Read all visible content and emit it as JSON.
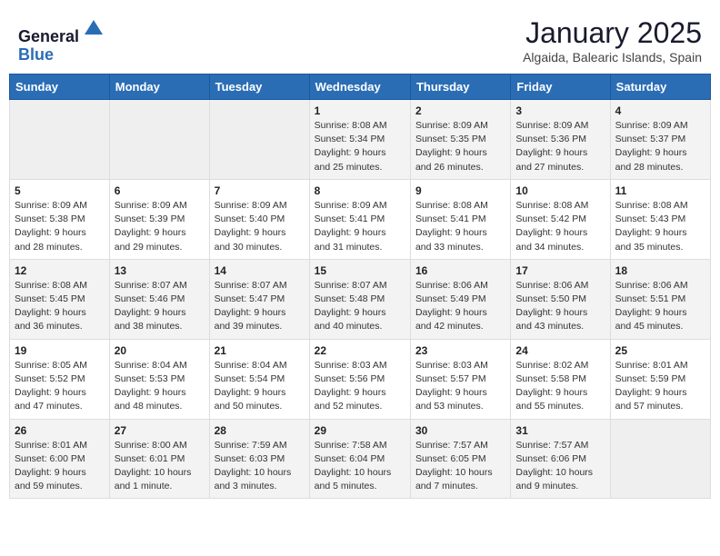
{
  "header": {
    "logo_line1": "General",
    "logo_line2": "Blue",
    "month": "January 2025",
    "location": "Algaida, Balearic Islands, Spain"
  },
  "weekdays": [
    "Sunday",
    "Monday",
    "Tuesday",
    "Wednesday",
    "Thursday",
    "Friday",
    "Saturday"
  ],
  "weeks": [
    [
      {
        "day": "",
        "info": ""
      },
      {
        "day": "",
        "info": ""
      },
      {
        "day": "",
        "info": ""
      },
      {
        "day": "1",
        "info": "Sunrise: 8:08 AM\nSunset: 5:34 PM\nDaylight: 9 hours\nand 25 minutes."
      },
      {
        "day": "2",
        "info": "Sunrise: 8:09 AM\nSunset: 5:35 PM\nDaylight: 9 hours\nand 26 minutes."
      },
      {
        "day": "3",
        "info": "Sunrise: 8:09 AM\nSunset: 5:36 PM\nDaylight: 9 hours\nand 27 minutes."
      },
      {
        "day": "4",
        "info": "Sunrise: 8:09 AM\nSunset: 5:37 PM\nDaylight: 9 hours\nand 28 minutes."
      }
    ],
    [
      {
        "day": "5",
        "info": "Sunrise: 8:09 AM\nSunset: 5:38 PM\nDaylight: 9 hours\nand 28 minutes."
      },
      {
        "day": "6",
        "info": "Sunrise: 8:09 AM\nSunset: 5:39 PM\nDaylight: 9 hours\nand 29 minutes."
      },
      {
        "day": "7",
        "info": "Sunrise: 8:09 AM\nSunset: 5:40 PM\nDaylight: 9 hours\nand 30 minutes."
      },
      {
        "day": "8",
        "info": "Sunrise: 8:09 AM\nSunset: 5:41 PM\nDaylight: 9 hours\nand 31 minutes."
      },
      {
        "day": "9",
        "info": "Sunrise: 8:08 AM\nSunset: 5:41 PM\nDaylight: 9 hours\nand 33 minutes."
      },
      {
        "day": "10",
        "info": "Sunrise: 8:08 AM\nSunset: 5:42 PM\nDaylight: 9 hours\nand 34 minutes."
      },
      {
        "day": "11",
        "info": "Sunrise: 8:08 AM\nSunset: 5:43 PM\nDaylight: 9 hours\nand 35 minutes."
      }
    ],
    [
      {
        "day": "12",
        "info": "Sunrise: 8:08 AM\nSunset: 5:45 PM\nDaylight: 9 hours\nand 36 minutes."
      },
      {
        "day": "13",
        "info": "Sunrise: 8:07 AM\nSunset: 5:46 PM\nDaylight: 9 hours\nand 38 minutes."
      },
      {
        "day": "14",
        "info": "Sunrise: 8:07 AM\nSunset: 5:47 PM\nDaylight: 9 hours\nand 39 minutes."
      },
      {
        "day": "15",
        "info": "Sunrise: 8:07 AM\nSunset: 5:48 PM\nDaylight: 9 hours\nand 40 minutes."
      },
      {
        "day": "16",
        "info": "Sunrise: 8:06 AM\nSunset: 5:49 PM\nDaylight: 9 hours\nand 42 minutes."
      },
      {
        "day": "17",
        "info": "Sunrise: 8:06 AM\nSunset: 5:50 PM\nDaylight: 9 hours\nand 43 minutes."
      },
      {
        "day": "18",
        "info": "Sunrise: 8:06 AM\nSunset: 5:51 PM\nDaylight: 9 hours\nand 45 minutes."
      }
    ],
    [
      {
        "day": "19",
        "info": "Sunrise: 8:05 AM\nSunset: 5:52 PM\nDaylight: 9 hours\nand 47 minutes."
      },
      {
        "day": "20",
        "info": "Sunrise: 8:04 AM\nSunset: 5:53 PM\nDaylight: 9 hours\nand 48 minutes."
      },
      {
        "day": "21",
        "info": "Sunrise: 8:04 AM\nSunset: 5:54 PM\nDaylight: 9 hours\nand 50 minutes."
      },
      {
        "day": "22",
        "info": "Sunrise: 8:03 AM\nSunset: 5:56 PM\nDaylight: 9 hours\nand 52 minutes."
      },
      {
        "day": "23",
        "info": "Sunrise: 8:03 AM\nSunset: 5:57 PM\nDaylight: 9 hours\nand 53 minutes."
      },
      {
        "day": "24",
        "info": "Sunrise: 8:02 AM\nSunset: 5:58 PM\nDaylight: 9 hours\nand 55 minutes."
      },
      {
        "day": "25",
        "info": "Sunrise: 8:01 AM\nSunset: 5:59 PM\nDaylight: 9 hours\nand 57 minutes."
      }
    ],
    [
      {
        "day": "26",
        "info": "Sunrise: 8:01 AM\nSunset: 6:00 PM\nDaylight: 9 hours\nand 59 minutes."
      },
      {
        "day": "27",
        "info": "Sunrise: 8:00 AM\nSunset: 6:01 PM\nDaylight: 10 hours\nand 1 minute."
      },
      {
        "day": "28",
        "info": "Sunrise: 7:59 AM\nSunset: 6:03 PM\nDaylight: 10 hours\nand 3 minutes."
      },
      {
        "day": "29",
        "info": "Sunrise: 7:58 AM\nSunset: 6:04 PM\nDaylight: 10 hours\nand 5 minutes."
      },
      {
        "day": "30",
        "info": "Sunrise: 7:57 AM\nSunset: 6:05 PM\nDaylight: 10 hours\nand 7 minutes."
      },
      {
        "day": "31",
        "info": "Sunrise: 7:57 AM\nSunset: 6:06 PM\nDaylight: 10 hours\nand 9 minutes."
      },
      {
        "day": "",
        "info": ""
      }
    ]
  ]
}
